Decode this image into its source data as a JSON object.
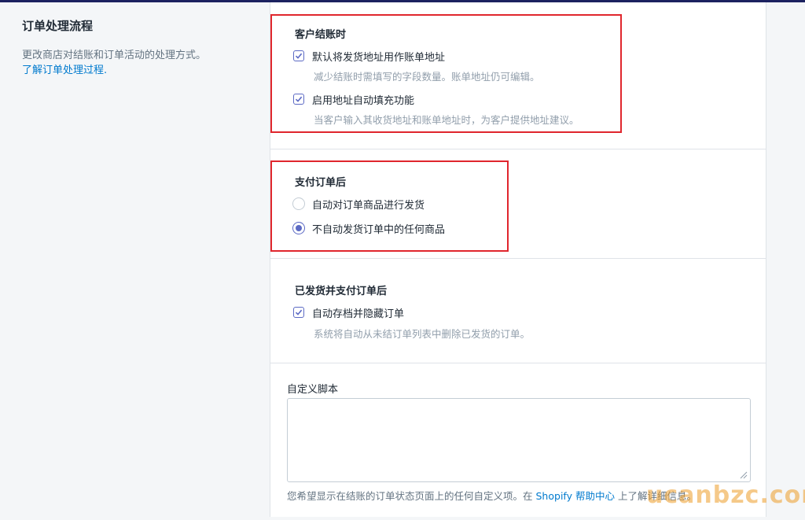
{
  "colors": {
    "accent": "#5c6ac4",
    "link": "#007ace",
    "highlight": "#e0262d",
    "muted": "#919eab"
  },
  "sidebar": {
    "title": "订单处理流程",
    "desc": "更改商店对结账和订单活动的处理方式。",
    "link": "了解订单处理过程."
  },
  "checkout": {
    "title": "客户结账时",
    "options": [
      {
        "label": "默认将发货地址用作账单地址",
        "help": "减少结账时需填写的字段数量。账单地址仍可编辑。",
        "checked": true,
        "icon": "checkbox-icon"
      },
      {
        "label": "启用地址自动填充功能",
        "help": "当客户输入其收货地址和账单地址时，为客户提供地址建议。",
        "checked": true,
        "icon": "checkbox-icon"
      }
    ]
  },
  "after_payment": {
    "title": "支付订单后",
    "options": [
      {
        "label": "自动对订单商品进行发货",
        "selected": false,
        "icon": "radio-icon"
      },
      {
        "label": "不自动发货订单中的任何商品",
        "selected": true,
        "icon": "radio-icon"
      }
    ]
  },
  "after_fulfill": {
    "title": "已发货并支付订单后",
    "options": [
      {
        "label": "自动存档并隐藏订单",
        "help": "系统将自动从未结订单列表中删除已发货的订单。",
        "checked": true,
        "icon": "checkbox-icon"
      }
    ]
  },
  "custom_script": {
    "label": "自定义脚本",
    "value": "",
    "help_before": "您希望显示在结账的订单状态页面上的任何自定义项。在",
    "help_link": "Shopify 帮助中心",
    "help_after": "上了解详细信息。"
  },
  "watermark": "ucanbzc.com"
}
